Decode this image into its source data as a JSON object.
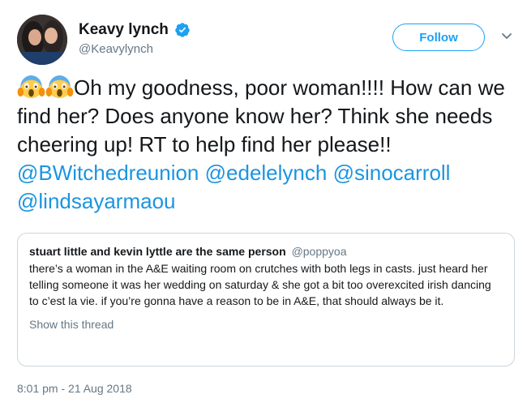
{
  "author": {
    "display_name": "Keavy lynch",
    "handle": "@Keavylynch",
    "verified": true
  },
  "follow_label": "Follow",
  "tweet": {
    "emoji": "face-screaming-in-fear",
    "emoji_count": 2,
    "text": "Oh my goodness, poor woman!!!! How can we find her? Does anyone know her? Think she needs cheering up! RT to help find her please!! ",
    "mentions": [
      "@BWitchedreunion",
      "@edelelynch",
      "@sinocarroll",
      "@lindsayarmaou"
    ]
  },
  "quoted_tweet": {
    "author_name": "stuart little and kevin lyttle are the same person",
    "author_handle": "@poppyoa",
    "text": "there’s a woman in the A&E waiting room on crutches with both legs in casts. just heard her telling someone it was her wedding on saturday & she got a bit too overexcited irish dancing to c’est la vie. if you’re gonna have a reason to be in A&E, that should always be it.",
    "show_thread_label": "Show this thread"
  },
  "timestamp": "8:01 pm - 21 Aug 2018",
  "colors": {
    "accent": "#1da1f2",
    "mention": "#1b95e0",
    "secondary_text": "#657786",
    "border": "#ccd6dd"
  }
}
